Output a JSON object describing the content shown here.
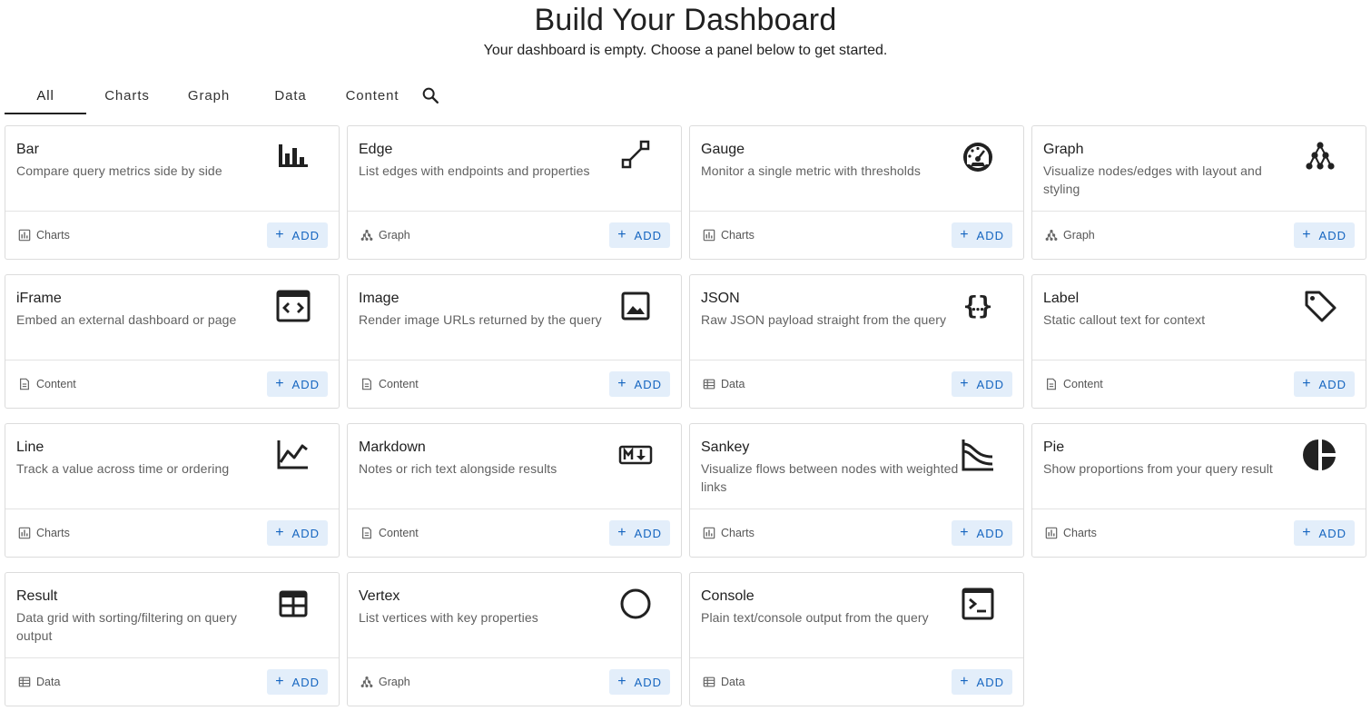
{
  "header": {
    "title": "Build Your Dashboard",
    "subtitle": "Your dashboard is empty. Choose a panel below to get started."
  },
  "tabs": [
    {
      "label": "All",
      "active": true
    },
    {
      "label": "Charts",
      "active": false
    },
    {
      "label": "Graph",
      "active": false
    },
    {
      "label": "Data",
      "active": false
    },
    {
      "label": "Content",
      "active": false
    }
  ],
  "add_label": "ADD",
  "cards": [
    {
      "name": "Bar",
      "desc": "Compare query metrics side by side",
      "category": "Charts",
      "icon": "bar-chart-icon"
    },
    {
      "name": "Edge",
      "desc": "List edges with endpoints and properties",
      "category": "Graph",
      "icon": "edge-icon"
    },
    {
      "name": "Gauge",
      "desc": "Monitor a single metric with thresholds",
      "category": "Charts",
      "icon": "gauge-icon"
    },
    {
      "name": "Graph",
      "desc": "Visualize nodes/edges with layout and styling",
      "category": "Graph",
      "icon": "graph-icon"
    },
    {
      "name": "iFrame",
      "desc": "Embed an external dashboard or page",
      "category": "Content",
      "icon": "code-window-icon"
    },
    {
      "name": "Image",
      "desc": "Render image URLs returned by the query",
      "category": "Content",
      "icon": "image-icon"
    },
    {
      "name": "JSON",
      "desc": "Raw JSON payload straight from the query",
      "category": "Data",
      "icon": "json-braces-icon"
    },
    {
      "name": "Label",
      "desc": "Static callout text for context",
      "category": "Content",
      "icon": "tag-icon"
    },
    {
      "name": "Line",
      "desc": "Track a value across time or ordering",
      "category": "Charts",
      "icon": "line-chart-icon"
    },
    {
      "name": "Markdown",
      "desc": "Notes or rich text alongside results",
      "category": "Content",
      "icon": "markdown-icon"
    },
    {
      "name": "Sankey",
      "desc": "Visualize flows between nodes with weighted links",
      "category": "Charts",
      "icon": "sankey-icon"
    },
    {
      "name": "Pie",
      "desc": "Show proportions from your query result",
      "category": "Charts",
      "icon": "pie-chart-icon"
    },
    {
      "name": "Result",
      "desc": "Data grid with sorting/filtering on query output",
      "category": "Data",
      "icon": "table-icon"
    },
    {
      "name": "Vertex",
      "desc": "List vertices with key properties",
      "category": "Graph",
      "icon": "circle-icon"
    },
    {
      "name": "Console",
      "desc": "Plain text/console output from the query",
      "category": "Data",
      "icon": "terminal-icon"
    }
  ]
}
